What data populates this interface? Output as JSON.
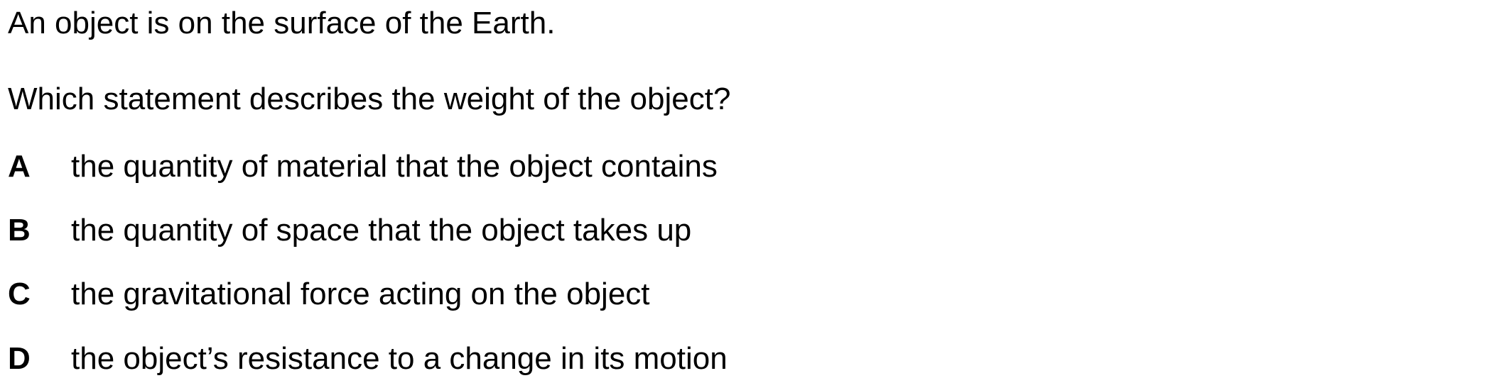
{
  "question": {
    "intro": "An object is on the surface of the Earth.",
    "prompt": "Which statement describes the weight of the object?",
    "options": [
      {
        "letter": "A",
        "text": "the quantity of material that the object contains"
      },
      {
        "letter": "B",
        "text": "the quantity of space that the object takes up"
      },
      {
        "letter": "C",
        "text": "the gravitational force acting on the object"
      },
      {
        "letter": "D",
        "text": "the object’s resistance to a change in its motion"
      }
    ]
  }
}
